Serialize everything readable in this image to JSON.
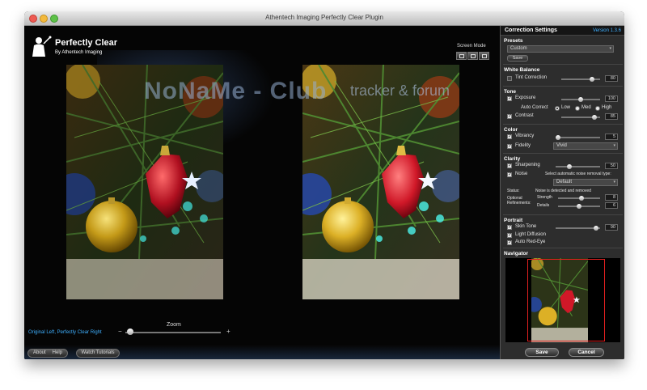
{
  "window": {
    "title": "Athentech Imaging Perfectly Clear Plugin"
  },
  "logo": {
    "title": "Perfectly Clear",
    "subtitle": "By Athentech Imaging"
  },
  "screen_mode": {
    "label": "Screen Mode"
  },
  "watermark": {
    "main": "NoNaMe - Club",
    "sub": "tracker & forum"
  },
  "zoom": {
    "label": "Zoom",
    "minus": "−",
    "plus": "+",
    "level": 0.05
  },
  "compare": {
    "label": "Original Left, Perfectly Clear Right"
  },
  "bottom_buttons": {
    "about": "About",
    "help": "Help",
    "tutorials": "Watch Tutorials"
  },
  "panel": {
    "title": "Correction Settings",
    "version": "Version 1.3.6",
    "presets": {
      "title": "Presets",
      "value": "Custom",
      "save_label": "Save"
    },
    "white_balance": {
      "title": "White Balance",
      "tint_label": "Tint Correction",
      "tint_checked": false,
      "tint_value": "80",
      "tint_level": 0.8
    },
    "tone": {
      "title": "Tone",
      "exposure_label": "Exposure",
      "exposure_value": "100",
      "exposure_level": 0.5,
      "auto_correct_label": "Auto Correct",
      "auto_options": [
        "Low",
        "Med",
        "High"
      ],
      "auto_selected": 0,
      "contrast_label": "Contrast",
      "contrast_value": "85",
      "contrast_level": 0.85
    },
    "color": {
      "title": "Color",
      "vibrancy_label": "Vibrancy",
      "vibrancy_value": "5",
      "vibrancy_level": 0.05,
      "fidelity_label": "Fidelity",
      "fidelity_value": "Vivid"
    },
    "clarity": {
      "title": "Clarity",
      "sharpening_label": "Sharpening",
      "sharpening_value": "50",
      "sharpening_level": 0.3,
      "noise_label": "Noise",
      "noise_type_label": "Select automatic noise removal type:",
      "noise_type_value": "Default",
      "status_label": "Status:",
      "status_text": "Noise is detected and removed",
      "optional_label": "Optional Refinements:",
      "strength_label": "Strength",
      "strength_value": "8",
      "strength_level": 0.55,
      "details_label": "Details",
      "details_value": "6",
      "details_level": 0.5
    },
    "portrait": {
      "title": "Portrait",
      "skin_label": "Skin Tone",
      "skin_value": "90",
      "skin_level": 0.9,
      "light_label": "Light Diffusion",
      "redeye_label": "Auto Red-Eye"
    },
    "navigator": {
      "title": "Navigator"
    },
    "save_button": "Save",
    "cancel_button": "Cancel"
  },
  "colors": {
    "accent": "#3fb0ff",
    "nav_frame": "#e02020"
  }
}
